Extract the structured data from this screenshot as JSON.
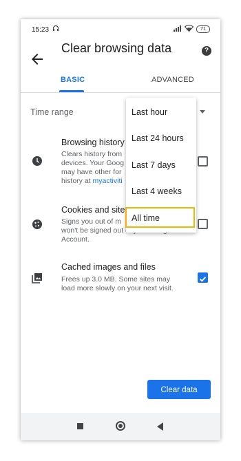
{
  "status_bar": {
    "time": "15:23",
    "battery": "71"
  },
  "toolbar": {
    "title": "Clear browsing data",
    "help": "?"
  },
  "tabs": [
    {
      "label": "BASIC"
    },
    {
      "label": "ADVANCED"
    }
  ],
  "time_range": {
    "label": "Time range"
  },
  "options": [
    {
      "title": "Browsing history",
      "desc_lines": [
        "Clears history from",
        "devices. Your Goog",
        "may have other for"
      ],
      "desc_prefix": "history at ",
      "desc_link": "myactiviti",
      "checked": false
    },
    {
      "title": "Cookies and site",
      "desc_lines": [
        "Signs you out of m",
        "won't be signed out of your Google",
        "Account."
      ],
      "checked": false
    },
    {
      "title": "Cached images and files",
      "desc_lines": [
        "Frees up 3.0 MB. Some sites may",
        "load more slowly on your next visit."
      ],
      "checked": true
    }
  ],
  "dropdown": {
    "options": [
      "Last hour",
      "Last 24 hours",
      "Last 7 days",
      "Last 4 weeks",
      "All time"
    ],
    "highlighted": "All time"
  },
  "clear_button": {
    "label": "Clear data"
  },
  "colors": {
    "accent": "#1a73e8",
    "highlight": "#f4b400"
  }
}
